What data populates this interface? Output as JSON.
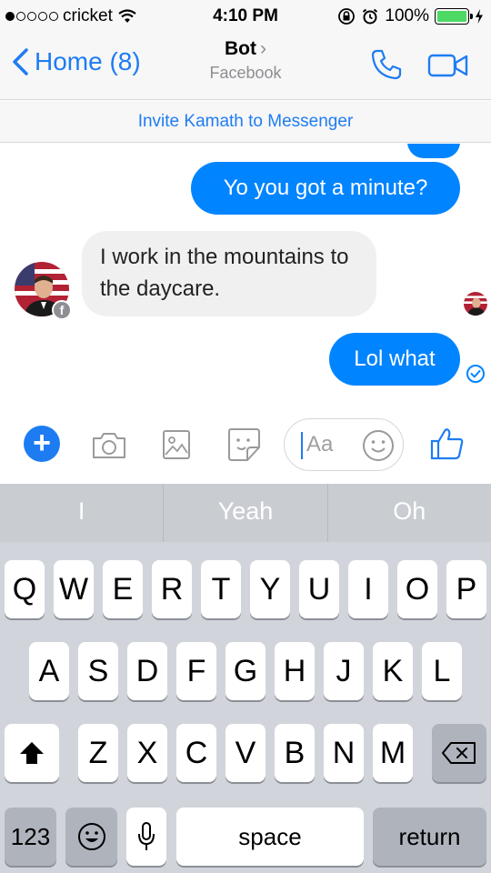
{
  "status_bar": {
    "carrier": "cricket",
    "time": "4:10 PM",
    "battery": "100%"
  },
  "nav": {
    "back_label": "Home (8)",
    "title": "Bot",
    "subtitle": "Facebook"
  },
  "invite_banner": "Invite Kamath to Messenger",
  "messages": [
    {
      "from": "me",
      "text": "Yo you got a minute?"
    },
    {
      "from": "bot",
      "text": "I work in the mountains to the daycare."
    },
    {
      "from": "me",
      "text": "Lol what"
    }
  ],
  "composer": {
    "placeholder": "Aa"
  },
  "keyboard": {
    "suggestions": [
      "I",
      "Yeah",
      "Oh"
    ],
    "row1": [
      "Q",
      "W",
      "E",
      "R",
      "T",
      "Y",
      "U",
      "I",
      "O",
      "P"
    ],
    "row2": [
      "A",
      "S",
      "D",
      "F",
      "G",
      "H",
      "J",
      "K",
      "L"
    ],
    "row3": [
      "Z",
      "X",
      "C",
      "V",
      "B",
      "N",
      "M"
    ],
    "numbers_key": "123",
    "space_key": "space",
    "return_key": "return"
  },
  "colors": {
    "accent": "#0084ff",
    "link": "#1e7cf2",
    "incoming_bubble": "#f1f0f0"
  }
}
